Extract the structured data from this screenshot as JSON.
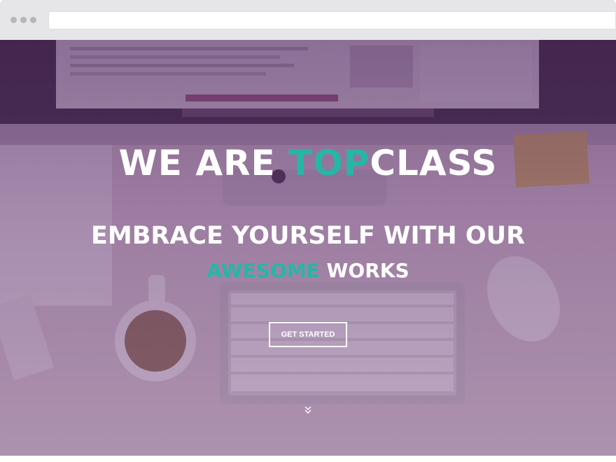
{
  "hero": {
    "headline_part1": "WE ARE ",
    "headline_accent": "TOP",
    "headline_part2": "CLASS",
    "subheadline_line1": "EMBRACE YOURSELF WITH OUR",
    "subheadline_accent": "AWESOME",
    "subheadline_end": " WORKS",
    "cta_label": "GET STARTED"
  },
  "colors": {
    "accent": "#26b6a6",
    "overlay": "#5a2a66",
    "chrome": "#e6e6e8"
  },
  "icons": {
    "scroll": "chevron-double-down-icon"
  }
}
